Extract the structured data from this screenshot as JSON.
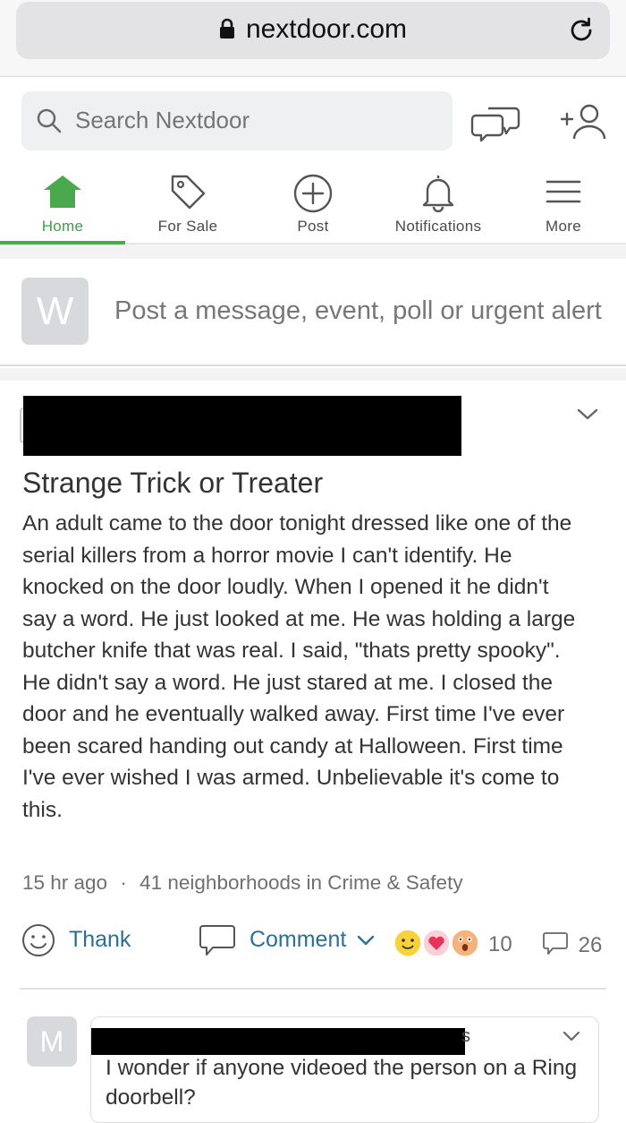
{
  "browser": {
    "url": "nextdoor.com",
    "icons": [
      "lock-icon",
      "reload-icon"
    ]
  },
  "header": {
    "search_placeholder": "Search Nextdoor",
    "icons": [
      "search-icon",
      "messages-icon",
      "add-neighbor-icon"
    ]
  },
  "nav": {
    "tabs": [
      {
        "label": "Home",
        "icon": "home-icon",
        "active": true
      },
      {
        "label": "For Sale",
        "icon": "tag-icon",
        "active": false
      },
      {
        "label": "Post",
        "icon": "plus-circle-icon",
        "active": false
      },
      {
        "label": "Notifications",
        "icon": "bell-icon",
        "active": false
      },
      {
        "label": "More",
        "icon": "menu-icon",
        "active": false
      }
    ]
  },
  "composer": {
    "avatar_letter": "W",
    "prompt": "Post a message, event, poll or urgent alert"
  },
  "post": {
    "title": "Strange Trick or Treater",
    "body": "An adult came to the door tonight dressed like one of the serial killers from a horror movie I can't identify. He knocked on the door loudly. When I opened it he didn't say a word. He just looked at me. He was holding a large butcher knife that was real. I said, \"thats pretty spooky\". He didn't say a word. He just stared at me. I closed the door and he eventually walked away. First time I've ever been scared handing out candy at Halloween. First time I've ever wished I was armed. Unbelievable it's come to this.",
    "time": "15 hr ago",
    "separator": "·",
    "audience": "41 neighborhoods in Crime & Safety",
    "thank_label": "Thank",
    "comment_label": "Comment",
    "reaction_count": "10",
    "comment_count": "26",
    "colors": {
      "accent_green": "#4aa94c",
      "link_blue": "#2d6f93"
    }
  },
  "comment": {
    "avatar_letter": "M",
    "name_fragment": "s",
    "text": "I wonder if anyone videoed the person on a Ring doorbell?"
  }
}
